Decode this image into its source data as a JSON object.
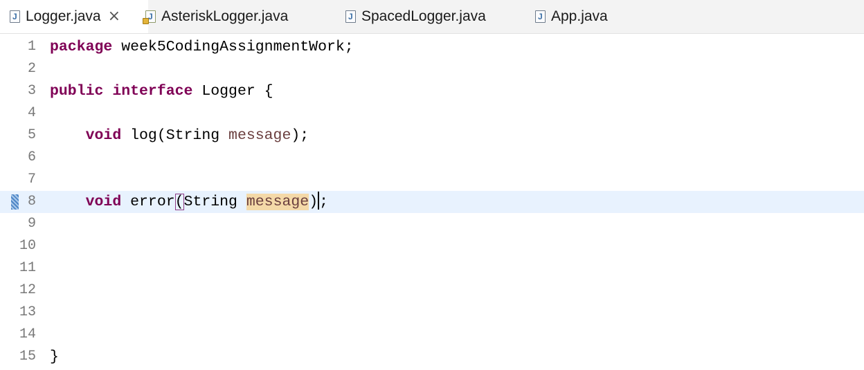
{
  "tabs": [
    {
      "label": "Logger.java",
      "active": true,
      "closable": true,
      "close_glyph": "×",
      "icon": "java-file-icon"
    },
    {
      "label": "AsteriskLogger.java",
      "active": false,
      "icon": "java-file-warning-icon"
    },
    {
      "label": "SpacedLogger.java",
      "active": false,
      "icon": "java-file-icon"
    },
    {
      "label": "App.java",
      "active": false,
      "icon": "java-file-icon"
    }
  ],
  "editor": {
    "line_numbers": [
      "1",
      "2",
      "3",
      "4",
      "5",
      "6",
      "7",
      "8",
      "9",
      "10",
      "11",
      "12",
      "13",
      "14",
      "15"
    ],
    "current_line": "8",
    "code": {
      "l1_kw": "package",
      "l1_rest": " week5CodingAssignmentWork;",
      "l3_kw1": "public",
      "l3_kw2": "interface",
      "l3_rest": " Logger {",
      "l5_kw": "void",
      "l5_mid": " log(String ",
      "l5_param": "message",
      "l5_end": ");",
      "l8_kw": "void",
      "l8_mid": " error",
      "l8_open": "(",
      "l8_type": "String ",
      "l8_param": "message",
      "l8_close": ")",
      "l8_end": ";",
      "l14": "}"
    }
  },
  "colors": {
    "keyword": "#7f0055",
    "parameter": "#6a3e3e",
    "current_line": "#e8f2fe",
    "occurrence": "#f4d9a8"
  }
}
